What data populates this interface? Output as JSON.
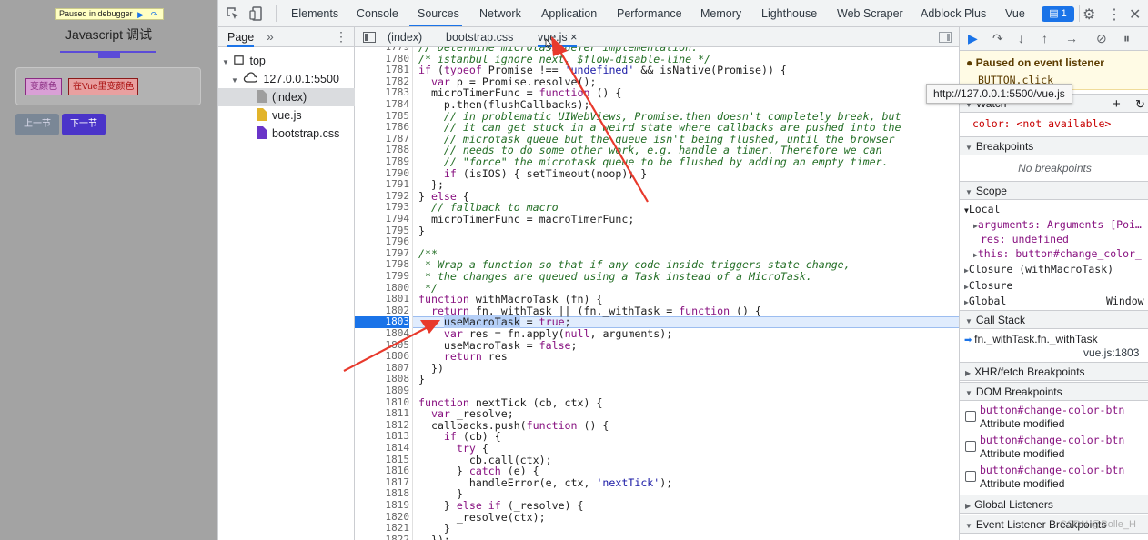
{
  "app": {
    "paused_label": "Paused in debugger",
    "title": "Javascript 调试",
    "color_buttons": [
      "变颜色",
      "在Vue里变颜色"
    ],
    "nav_buttons": [
      "上一节",
      "下一节"
    ]
  },
  "toolbar": {
    "tabs": [
      "Elements",
      "Console",
      "Sources",
      "Network",
      "Application",
      "Performance",
      "Memory",
      "Lighthouse",
      "Web Scraper",
      "Adblock Plus",
      "Vue"
    ],
    "active_tab": "Sources",
    "issues_count": "1"
  },
  "navigator": {
    "header": "Page",
    "more": "»",
    "tree": [
      "top",
      "127.0.0.1:5500",
      "(index)",
      "vue.js",
      "bootstrap.css"
    ]
  },
  "editor": {
    "tabs": [
      "(index)",
      "bootstrap.css",
      "vue.js"
    ],
    "close_glyph": "×",
    "tooltip": "http://127.0.0.1:5500/vue.js",
    "line_numbers": [
      "1779",
      "1780",
      "1781",
      "1782",
      "1783",
      "1784",
      "1785",
      "1786",
      "1787",
      "1788",
      "1789",
      "1790",
      "1791",
      "1792",
      "1793",
      "1794",
      "1795",
      "1796",
      "1797",
      "1798",
      "1799",
      "1800",
      "1801",
      "1802",
      "1803",
      "1804",
      "1805",
      "1806",
      "1807",
      "1808",
      "1809",
      "1810",
      "1811",
      "1812",
      "1813",
      "1814",
      "1815",
      "1816",
      "1817",
      "1818",
      "1819",
      "1820",
      "1821",
      "1822"
    ],
    "current_line": "1803"
  },
  "sidebar": {
    "paused_title": "Paused on event listener",
    "paused_detail": "BUTTON.click",
    "watch": "Watch",
    "watch_expr": "color: <not available>",
    "breakpoints": "Breakpoints",
    "no_breakpoints": "No breakpoints",
    "scope": "Scope",
    "local": "Local",
    "scope_rows": [
      "arguments: Arguments [Poi…",
      "res: undefined",
      "this: button#change_color_"
    ],
    "closure_with": "Closure (withMacroTask)",
    "closure": "Closure",
    "global": "Global",
    "global_val": "Window",
    "call_stack": "Call Stack",
    "frame_name": "fn._withTask.fn._withTask",
    "frame_loc": "vue.js:1803",
    "xhr": "XHR/fetch Breakpoints",
    "dom": "DOM Breakpoints",
    "dom_target": "button#change-color-btn",
    "dom_desc": "Attribute modified",
    "global_listeners": "Global Listeners",
    "event_listener_bps": "Event Listener Breakpoints",
    "watermark": "CSDN @Bolle_H"
  },
  "colors": {
    "accent": "#1a73e8",
    "annotation_arrow": "#e8392c",
    "paused_banner": "#fffbe5"
  }
}
